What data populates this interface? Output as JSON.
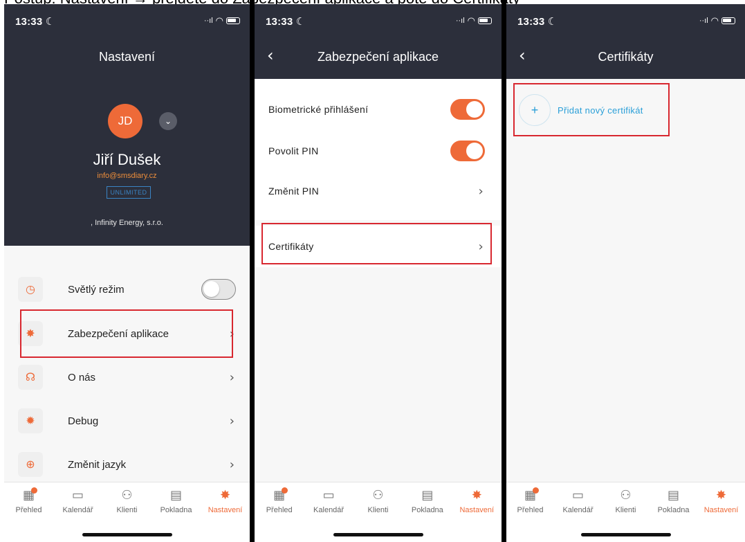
{
  "caption": "Postup: Nastavení → přejděte do Zabezpečení aplikace a poté do Certifikáty",
  "status": {
    "time": "13:33 ☾",
    "signal": "▂▄ ᯤ"
  },
  "screen1": {
    "title": "Nastavení",
    "avatar_initials": "JD",
    "user_name": "Jiří Dušek",
    "email": "info@smsdiary.cz",
    "plan": "UNLIMITED",
    "company": ", Infinity Energy, s.r.o.",
    "menu": [
      {
        "label": "Světlý režim",
        "icon": "speedometer-icon"
      },
      {
        "label": "Zabezpečení aplikace",
        "icon": "gear-icon"
      },
      {
        "label": "O nás",
        "icon": "headphones-icon"
      },
      {
        "label": "Debug",
        "icon": "bug-icon"
      },
      {
        "label": "Změnit jazyk",
        "icon": "globe-icon"
      }
    ]
  },
  "screen2": {
    "title": "Zabezpečení aplikace",
    "rows": [
      {
        "label": "Biometrické přihlášení",
        "toggle": true
      },
      {
        "label": "Povolit PIN",
        "toggle": true
      },
      {
        "label": "Změnit PIN"
      }
    ],
    "certificates_label": "Certifikáty"
  },
  "screen3": {
    "title": "Certifikáty",
    "add_label": "Přidat nový certifikát"
  },
  "tabbar": {
    "tabs": [
      {
        "label": "Přehled",
        "icon": "dashboard-icon"
      },
      {
        "label": "Kalendář",
        "icon": "calendar-icon"
      },
      {
        "label": "Klienti",
        "icon": "users-icon"
      },
      {
        "label": "Pokladna",
        "icon": "receipt-icon"
      },
      {
        "label": "Nastavení",
        "icon": "gear-icon",
        "active": true
      }
    ]
  },
  "colors": {
    "accent": "#ee6a38",
    "header": "#2c2f3b",
    "highlight": "#d8272f",
    "link": "#2a9fd8"
  }
}
